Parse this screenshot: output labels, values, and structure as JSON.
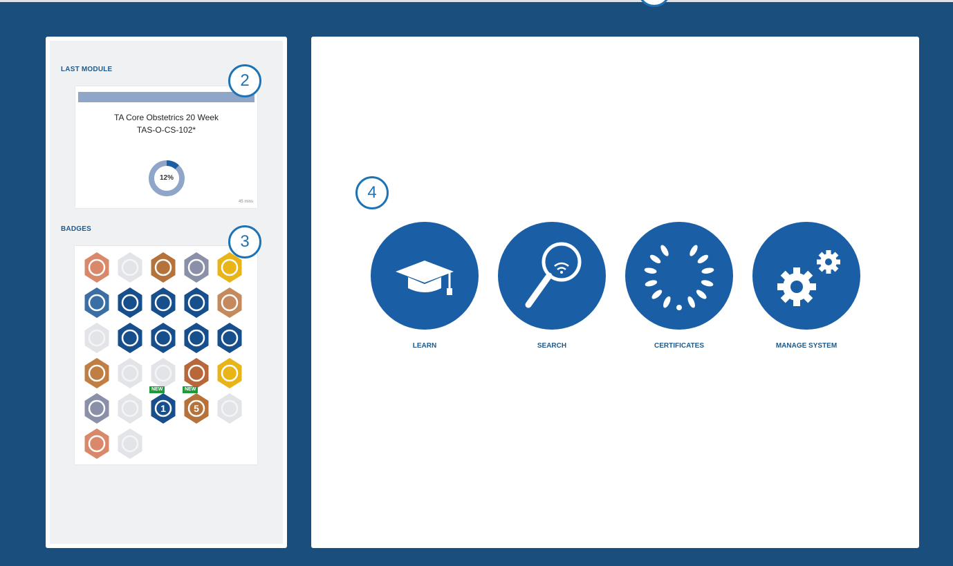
{
  "callouts": {
    "last_module": "2",
    "badges": "3",
    "nav": "4"
  },
  "last_module": {
    "heading": "LAST MODULE",
    "title_line1": "TA Core Obstetrics 20 Week",
    "title_line2": "TAS-O-CS-102*",
    "progress_label": "12%",
    "progress_fraction": 0.12,
    "duration": "45 mins",
    "bar_color": "#8fa6c9"
  },
  "badges": {
    "heading": "BADGES",
    "new_label": "NEW",
    "items": [
      {
        "icon": "certificate-badge-icon",
        "color": "#d9896a",
        "earned": true
      },
      {
        "icon": "certificate-badge-icon",
        "color": "#e2e4e8",
        "earned": false
      },
      {
        "icon": "open-book-badge-icon",
        "color": "#b5723a",
        "earned": true
      },
      {
        "icon": "book-stack-badge-icon",
        "color": "#8a90a8",
        "earned": true
      },
      {
        "icon": "library-badge-icon",
        "color": "#e8b418",
        "earned": true
      },
      {
        "icon": "owl-badge-icon",
        "color": "#3a6ea5",
        "earned": true
      },
      {
        "icon": "stopwatch-badge-icon",
        "color": "#164f8c",
        "earned": true
      },
      {
        "icon": "stopwatch-badge-icon",
        "color": "#164f8c",
        "earned": true
      },
      {
        "icon": "stopwatch-badge-icon",
        "color": "#164f8c",
        "earned": true
      },
      {
        "icon": "stopwatch-badge-icon",
        "color": "#c48a5e",
        "earned": true
      },
      {
        "icon": "stopwatch-badge-icon",
        "color": "#e2e4e8",
        "earned": false
      },
      {
        "icon": "medal-badge-icon",
        "color": "#164f8c",
        "earned": true
      },
      {
        "icon": "medal-badge-icon",
        "color": "#164f8c",
        "earned": true
      },
      {
        "icon": "medal-badge-icon",
        "color": "#164f8c",
        "earned": true
      },
      {
        "icon": "medal-badge-icon",
        "color": "#164f8c",
        "earned": true
      },
      {
        "icon": "trophy-badge-icon",
        "color": "#c07e42",
        "earned": true
      },
      {
        "icon": "trophy-badge-icon",
        "color": "#e2e4e8",
        "earned": false
      },
      {
        "icon": "graduation-cap-badge-icon",
        "color": "#e2e4e8",
        "earned": false
      },
      {
        "icon": "cloud-signal-badge-icon",
        "color": "#b8673a",
        "earned": true
      },
      {
        "icon": "cloud-signal-badge-icon",
        "color": "#e8b418",
        "earned": true
      },
      {
        "icon": "cloud-signal-badge-icon",
        "color": "#8a90a8",
        "earned": true
      },
      {
        "icon": "cloud-signal-badge-icon",
        "color": "#e2e4e8",
        "earned": false
      },
      {
        "icon": "laurel-badge-icon",
        "color": "#164f8c",
        "earned": true,
        "number": "1",
        "is_new": true
      },
      {
        "icon": "laurel-badge-icon",
        "color": "#b5723a",
        "earned": true,
        "number": "5",
        "is_new": true
      },
      {
        "icon": "laurel-badge-icon",
        "color": "#e2e4e8",
        "earned": false
      },
      {
        "icon": "cloud-upload-badge-icon",
        "color": "#d9896a",
        "earned": true
      },
      {
        "icon": "cloud-upload-badge-icon",
        "color": "#e2e4e8",
        "earned": false
      }
    ]
  },
  "nav": {
    "color": "#1a5fa5",
    "tiles": [
      {
        "label": "LEARN",
        "icon": "graduation-cap-icon"
      },
      {
        "label": "SEARCH",
        "icon": "magnifying-glass-icon"
      },
      {
        "label": "CERTIFICATES",
        "icon": "laurel-wreath-icon"
      },
      {
        "label": "MANAGE SYSTEM",
        "icon": "gears-icon"
      }
    ]
  }
}
